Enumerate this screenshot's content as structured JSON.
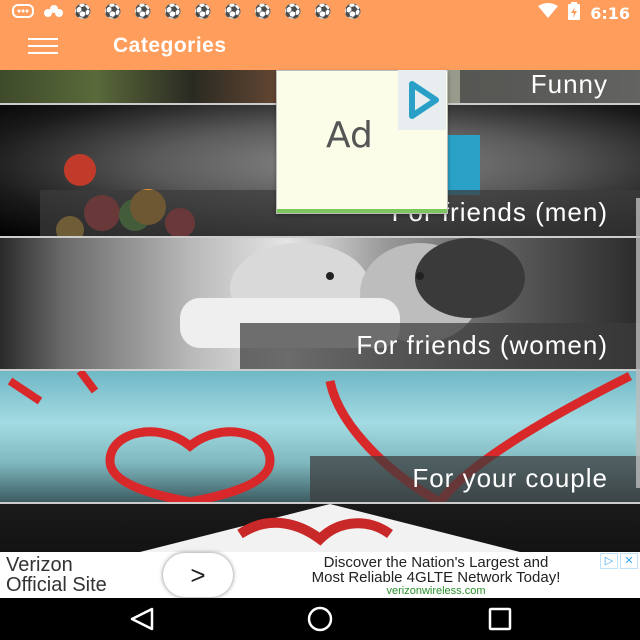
{
  "status_bar": {
    "time": "6:16",
    "notification_icons": [
      "messenger-icon",
      "dots-icon",
      "soccer-icon",
      "soccer-icon",
      "soccer-icon",
      "soccer-icon",
      "soccer-icon",
      "soccer-icon",
      "soccer-icon",
      "soccer-icon",
      "soccer-icon",
      "soccer-icon"
    ],
    "signal_icon": "wifi-icon",
    "battery_icon": "battery-icon"
  },
  "app_bar": {
    "title": "Categories",
    "menu_icon": "hamburger-menu-icon",
    "background": "#ff9d5c"
  },
  "categories": [
    {
      "label": "Funny"
    },
    {
      "label": "For friends (men)"
    },
    {
      "label": "For friends (women)"
    },
    {
      "label": "For your couple"
    },
    {
      "label": ""
    }
  ],
  "ad_popup": {
    "text": "Ad",
    "logo_icon": "play-triangle-logo-icon"
  },
  "banner_ad": {
    "brand_line1": "Verizon",
    "brand_line2": "Official Site",
    "button_symbol": ">",
    "headline_line1": "Discover the Nation's Largest and",
    "headline_line2": "Most Reliable 4GLTE Network Today!",
    "url": "verizonwireless.com",
    "adchoices_icons": [
      "adchoices-icon",
      "close-icon"
    ]
  },
  "nav_bar": {
    "buttons": [
      "back-icon",
      "home-icon",
      "recents-icon"
    ]
  }
}
